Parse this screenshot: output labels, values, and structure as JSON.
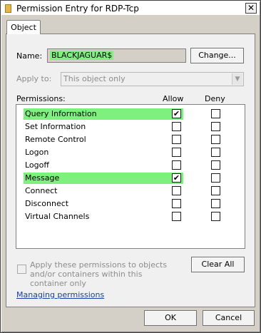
{
  "window": {
    "title": "Permission Entry for RDP-Tcp",
    "close_glyph": "✕"
  },
  "tabs": [
    {
      "label": "Object"
    }
  ],
  "name": {
    "label": "Name:",
    "value": "BLACKJAGUAR$",
    "change_button": "Change..."
  },
  "apply_to": {
    "label": "Apply to:",
    "value": "This object only"
  },
  "permissions": {
    "label": "Permissions:",
    "allow_header": "Allow",
    "deny_header": "Deny",
    "rows": [
      {
        "name": "Query Information",
        "allow": true,
        "deny": false,
        "highlight": true
      },
      {
        "name": "Set Information",
        "allow": false,
        "deny": false,
        "highlight": false
      },
      {
        "name": "Remote Control",
        "allow": false,
        "deny": false,
        "highlight": false
      },
      {
        "name": "Logon",
        "allow": false,
        "deny": false,
        "highlight": false
      },
      {
        "name": "Logoff",
        "allow": false,
        "deny": false,
        "highlight": false
      },
      {
        "name": "Message",
        "allow": true,
        "deny": false,
        "highlight": true
      },
      {
        "name": "Connect",
        "allow": false,
        "deny": false,
        "highlight": false
      },
      {
        "name": "Disconnect",
        "allow": false,
        "deny": false,
        "highlight": false
      },
      {
        "name": "Virtual Channels",
        "allow": false,
        "deny": false,
        "highlight": false
      }
    ]
  },
  "inherit": {
    "text": "Apply these permissions to objects and/or containers within this container only",
    "checked": false
  },
  "clear_all_button": "Clear All",
  "help_link": "Managing permissions",
  "footer": {
    "ok": "OK",
    "cancel": "Cancel"
  },
  "colors": {
    "highlight": "#7df07d",
    "link": "#1a3ea8"
  }
}
